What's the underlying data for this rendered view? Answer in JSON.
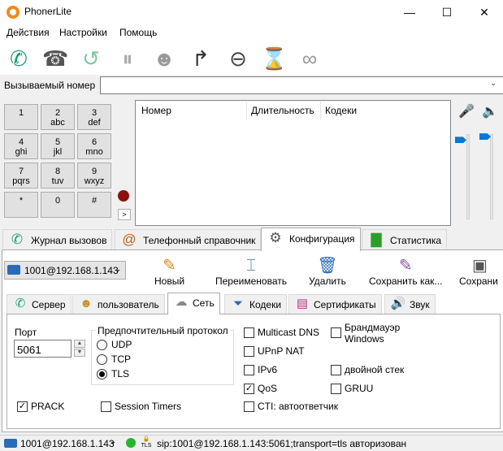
{
  "window": {
    "title": "PhonerLite",
    "minimize": "—",
    "maximize": "☐",
    "close": "✕"
  },
  "menu": {
    "items": [
      "Действия",
      "Настройки",
      "Помощь"
    ]
  },
  "toolbar_icons": [
    "call-icon",
    "hangup-icon",
    "callback-icon",
    "hold-icon",
    "conference-icon",
    "transfer-icon",
    "dnd-icon",
    "call-wait-icon",
    "anonymous-icon"
  ],
  "number": {
    "label": "Вызываемый номер",
    "value": "",
    "placeholder": ""
  },
  "keypad": [
    {
      "digit": "1",
      "letters": ""
    },
    {
      "digit": "2",
      "letters": "abc"
    },
    {
      "digit": "3",
      "letters": "def"
    },
    {
      "digit": "4",
      "letters": "ghi"
    },
    {
      "digit": "5",
      "letters": "jkl"
    },
    {
      "digit": "6",
      "letters": "mno"
    },
    {
      "digit": "7",
      "letters": "pqrs"
    },
    {
      "digit": "8",
      "letters": "tuv"
    },
    {
      "digit": "9",
      "letters": "wxyz"
    },
    {
      "digit": "*",
      "letters": ""
    },
    {
      "digit": "0",
      "letters": ""
    },
    {
      "digit": "#",
      "letters": ""
    }
  ],
  "keypad_more": ">",
  "calls": {
    "columns": [
      "Номер",
      "Длительность",
      "Кодеки"
    ]
  },
  "volume": {
    "mic_level": 0.93,
    "speaker_level": 0.97
  },
  "main_tabs": [
    {
      "label": "Журнал вызовов",
      "icon": "call-log-icon"
    },
    {
      "label": "Телефонный справочник",
      "icon": "phonebook-icon"
    },
    {
      "label": "Конфигурация",
      "icon": "gear-icon"
    },
    {
      "label": "Статистика",
      "icon": "chart-icon"
    }
  ],
  "config": {
    "account": "1001@192.168.1.143",
    "actions": [
      {
        "label": "Новый",
        "icon": "new-icon"
      },
      {
        "label": "Переименовать",
        "icon": "rename-icon"
      },
      {
        "label": "Удалить",
        "icon": "delete-icon"
      },
      {
        "label": "Сохранить как...",
        "icon": "save-as-icon"
      },
      {
        "label": "Сохрани",
        "icon": "save-icon"
      }
    ],
    "sub_tabs": [
      {
        "label": "Сервер",
        "icon": "server-icon"
      },
      {
        "label": "пользователь",
        "icon": "user-icon"
      },
      {
        "label": "Сеть",
        "icon": "network-icon"
      },
      {
        "label": "Кодеки",
        "icon": "codec-icon"
      },
      {
        "label": "Сертификаты",
        "icon": "certificate-icon"
      },
      {
        "label": "Звук",
        "icon": "sound-icon"
      }
    ],
    "network": {
      "port_label": "Порт",
      "port": "5061",
      "protocol_title": "Предпочтительный протокол",
      "protocols": [
        "UDP",
        "TCP",
        "TLS"
      ],
      "selected_protocol": "TLS",
      "checks_left": [
        {
          "label": "PRACK",
          "checked": true
        },
        {
          "label": "Session Timers",
          "checked": false
        }
      ],
      "checks_mid": [
        {
          "label": "Multicast DNS",
          "checked": false
        },
        {
          "label": "UPnP NAT",
          "checked": false
        },
        {
          "label": "IPv6",
          "checked": false
        },
        {
          "label": "QoS",
          "checked": true
        },
        {
          "label": "CTI: автоответчик",
          "checked": false
        }
      ],
      "checks_right": [
        {
          "label": "Брандмауэр",
          "label2": "Windows",
          "checked": false
        },
        {
          "label": "двойной стек",
          "checked": false
        },
        {
          "label": "GRUU",
          "checked": false
        }
      ]
    }
  },
  "status": {
    "account": "1001@192.168.1.143",
    "tls_label": "TLS",
    "text": "sip:1001@192.168.1.143:5061;transport=tls авторизован",
    "colors": {
      "online": "#2bb32b"
    }
  },
  "colors": {
    "accent": "#0078d7",
    "call_green": "#1a9c6e",
    "record": "#8b1010"
  }
}
